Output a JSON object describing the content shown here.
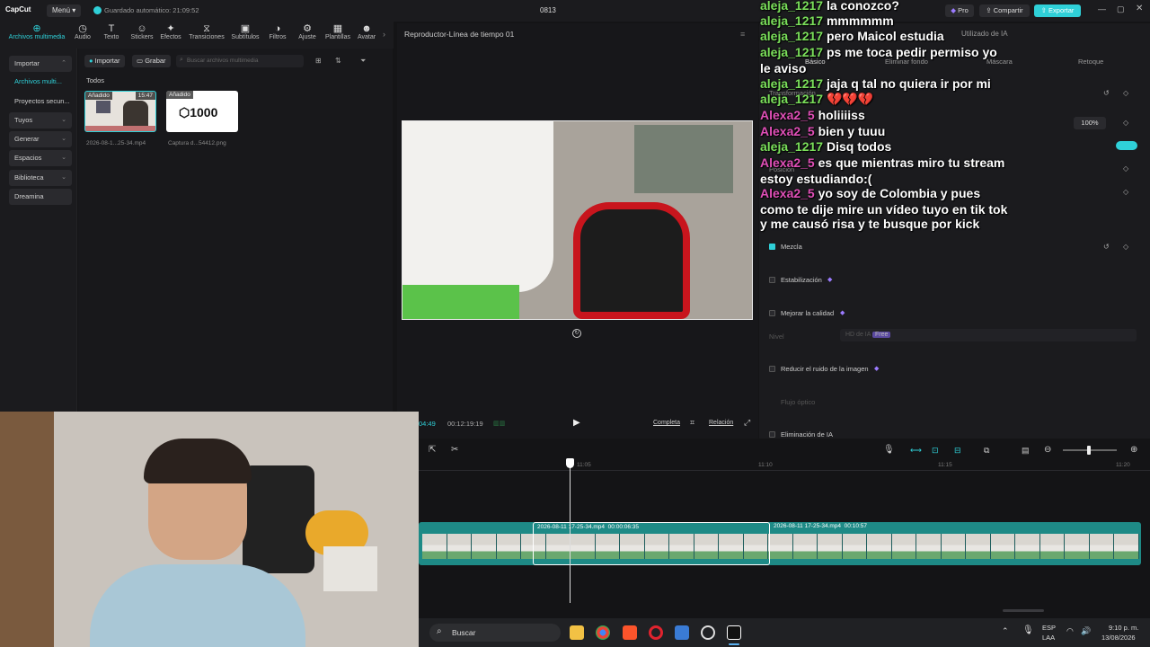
{
  "titlebar": {
    "app": "CapCut",
    "menu": "Menú",
    "autosave": "Guardado automático: 21:09:52",
    "project": "0813",
    "pro": "Pro",
    "share": "Compartir",
    "export": "Exportar"
  },
  "tools": [
    {
      "label": "Archivos multimedia",
      "icon": "media-icon"
    },
    {
      "label": "Audio",
      "icon": "audio-icon"
    },
    {
      "label": "Texto",
      "icon": "text-icon"
    },
    {
      "label": "Stickers",
      "icon": "sticker-icon"
    },
    {
      "label": "Efectos",
      "icon": "effects-icon"
    },
    {
      "label": "Transiciones",
      "icon": "transitions-icon"
    },
    {
      "label": "Subtítulos",
      "icon": "subtitles-icon"
    },
    {
      "label": "Filtros",
      "icon": "filters-icon"
    },
    {
      "label": "Ajuste",
      "icon": "adjust-icon"
    },
    {
      "label": "Plantillas",
      "icon": "templates-icon"
    },
    {
      "label": "Avatar",
      "icon": "avatar-icon"
    }
  ],
  "sidebar": {
    "items": [
      {
        "label": "Importar"
      },
      {
        "label": "Archivos multi..."
      },
      {
        "label": "Proyectos secun..."
      },
      {
        "label": "Tuyos"
      },
      {
        "label": "Generar"
      },
      {
        "label": "Espacios"
      },
      {
        "label": "Biblioteca"
      },
      {
        "label": "Dreamina"
      }
    ]
  },
  "media": {
    "import": "Importar",
    "record": "Grabar",
    "search_placeholder": "Buscar archivos multimedia",
    "filter_all": "Todos",
    "items": [
      {
        "badge": "Añadido",
        "duration": "15:47",
        "name": "2026-08-1...25-34.mp4"
      },
      {
        "badge": "Añadido",
        "name": "Captura d...54412.png",
        "thumb_text": "1000"
      }
    ]
  },
  "player": {
    "title": "Reproductor-Línea de tiempo 01",
    "current_time": "04:49",
    "total_time": "00:12:19:19",
    "full_label": "Completa",
    "ratio_label": "Relación"
  },
  "props": {
    "tab_partial": "Utilizado de IA",
    "subtabs": [
      "Básico",
      "Eliminar fondo",
      "Máscara",
      "Retoque"
    ],
    "transform": "Transformación",
    "scale_value": "100%",
    "position": "Posición",
    "sections": [
      {
        "label": "Mezcla",
        "checked": true
      },
      {
        "label": "Estabilización",
        "checked": false
      },
      {
        "label": "Mejorar la calidad",
        "checked": false
      },
      {
        "label": "Reducir el ruido de la imagen",
        "checked": false
      },
      {
        "label": "Eliminación de IA",
        "checked": false
      }
    ],
    "level_label": "Nivel",
    "level_value": "HD de IA",
    "level_tag": "Free",
    "flow_label": "Flujo óptico"
  },
  "chat": [
    {
      "nick": "aleja_1217",
      "color": "#7be05b",
      "msg": "la conozco?"
    },
    {
      "nick": "aleja_1217",
      "color": "#7be05b",
      "msg": "mmmmmm"
    },
    {
      "nick": "aleja_1217",
      "color": "#7be05b",
      "msg": "pero Maicol estudia"
    },
    {
      "nick": "aleja_1217",
      "color": "#7be05b",
      "msg": "ps me toca pedir permiso yo"
    },
    {
      "nick": "",
      "color": "#ffffff",
      "msg": "le aviso"
    },
    {
      "nick": "aleja_1217",
      "color": "#7be05b",
      "msg": "jaja q tal no quiera ir por mi"
    },
    {
      "nick": "aleja_1217",
      "color": "#7be05b",
      "msg": "💔💔💔"
    },
    {
      "nick": "Alexa2_5",
      "color": "#e04fb7",
      "msg": "holiiiiss"
    },
    {
      "nick": "Alexa2_5",
      "color": "#e04fb7",
      "msg": "bien y tuuu"
    },
    {
      "nick": "aleja_1217",
      "color": "#7be05b",
      "msg": "Disq todos"
    },
    {
      "nick": "Alexa2_5",
      "color": "#e04fb7",
      "msg": "es que mientras miro tu stream"
    },
    {
      "nick": "",
      "color": "#ffffff",
      "msg": "estoy estudiando:("
    },
    {
      "nick": "Alexa2_5",
      "color": "#e04fb7",
      "msg": "yo soy de Colombia y pues"
    },
    {
      "nick": "",
      "color": "#ffffff",
      "msg": "como te dije mire un vídeo tuyo en tik tok"
    },
    {
      "nick": "",
      "color": "#ffffff",
      "msg": "y me causó risa y te busque por kick"
    }
  ],
  "timeline": {
    "ticks": [
      "11:05",
      "11:10",
      "11:15",
      "11:20"
    ],
    "clip_selected": {
      "name": "2026-08-11 17-25-34.mp4",
      "duration": "00:00:06:35"
    },
    "clip_next": {
      "name": "2026-08-11 17-25-34.mp4",
      "duration": "00:10:57"
    }
  },
  "taskbar": {
    "search": "Buscar",
    "lang": "ESP",
    "layout": "LAA",
    "time": "9:10 p. m.",
    "date": "13/08/2026"
  },
  "colors": {
    "accent": "#2fd0d8",
    "track": "#1e8a86",
    "panel": "#1b1b1e"
  }
}
